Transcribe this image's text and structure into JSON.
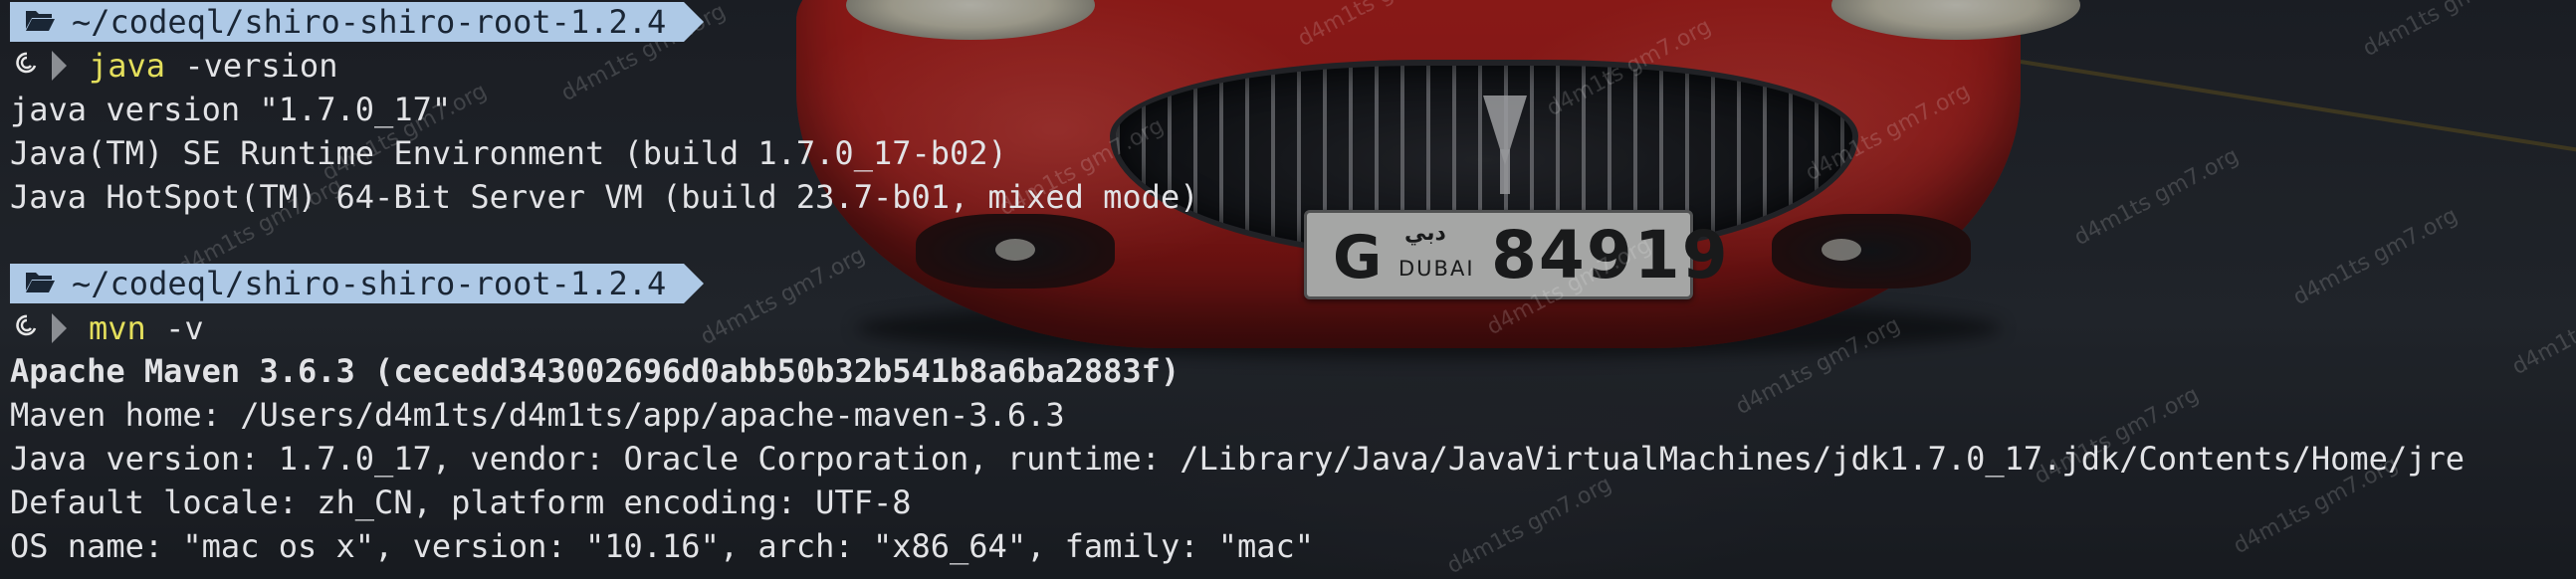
{
  "colors": {
    "prompt_bg": "#aec9e6",
    "prompt_fg": "#1a2635",
    "command_color": "#e4df5c",
    "output_color": "#e2e3e6",
    "car_red": "#c8221d"
  },
  "background": {
    "plate": {
      "letter": "G",
      "arabic": "دبي",
      "city": "DUBAI",
      "number": "84919"
    },
    "watermark_text": "d4m1ts gm7.org"
  },
  "terminal": {
    "blocks": [
      {
        "prompt": {
          "icon": "folder-open-icon",
          "path": "~/codeql/shiro-shiro-root-1.2.4"
        },
        "os_icon": "debian-swirl-icon",
        "command": "java",
        "args": " -version",
        "output": [
          "java version \"1.7.0_17\"",
          "Java(TM) SE Runtime Environment (build 1.7.0_17-b02)",
          "Java HotSpot(TM) 64-Bit Server VM (build 23.7-b01, mixed mode)"
        ]
      },
      {
        "prompt": {
          "icon": "folder-open-icon",
          "path": "~/codeql/shiro-shiro-root-1.2.4"
        },
        "os_icon": "debian-swirl-icon",
        "command": "mvn",
        "args": " -v",
        "output": [
          "Apache Maven 3.6.3 (cecedd343002696d0abb50b32b541b8a6ba2883f)",
          "Maven home: /Users/d4m1ts/d4m1ts/app/apache-maven-3.6.3",
          "Java version: 1.7.0_17, vendor: Oracle Corporation, runtime: /Library/Java/JavaVirtualMachines/jdk1.7.0_17.jdk/Contents/Home/jre",
          "Default locale: zh_CN, platform encoding: UTF-8",
          "OS name: \"mac os x\", version: \"10.16\", arch: \"x86_64\", family: \"mac\""
        ]
      }
    ]
  }
}
